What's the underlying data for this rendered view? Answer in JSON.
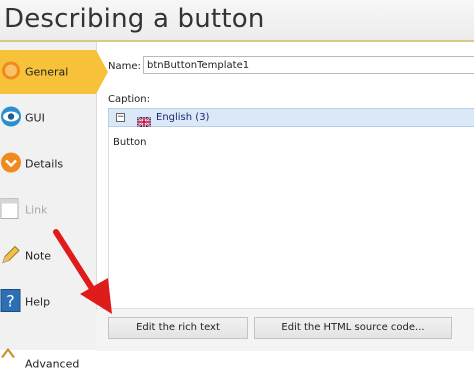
{
  "window": {
    "title": "Describing a button"
  },
  "sidebar": {
    "items": [
      {
        "label": "General",
        "icon": "general-icon",
        "state": "active"
      },
      {
        "label": "GUI",
        "icon": "eye-icon",
        "state": "normal"
      },
      {
        "label": "Details",
        "icon": "details-icon",
        "state": "normal"
      },
      {
        "label": "Link",
        "icon": "link-icon",
        "state": "disabled"
      },
      {
        "label": "Note",
        "icon": "pencil-icon",
        "state": "normal"
      },
      {
        "label": "Help",
        "icon": "help-icon",
        "state": "normal"
      },
      {
        "label": "Advanced",
        "icon": "advanced-icon",
        "state": "normal"
      }
    ]
  },
  "form": {
    "name_label": "Name:",
    "name_value": "btnButtonTemplate1",
    "caption_label": "Caption:",
    "language": {
      "expander": "−",
      "flag": "uk-flag-icon",
      "label": "English (3)"
    },
    "caption_value": "Button"
  },
  "buttons": {
    "rich_text": "Edit the rich text",
    "html_source": "Edit the HTML source code..."
  },
  "colors": {
    "active_nav": "#f7c23a",
    "language_bar": "#dbe8f8",
    "annotation_arrow": "#e01b1b"
  }
}
